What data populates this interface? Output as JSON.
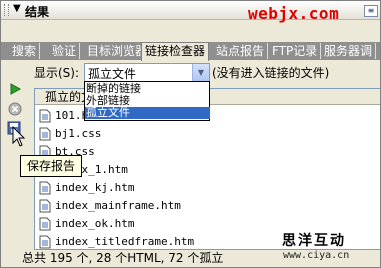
{
  "panel": {
    "title": "结果",
    "watermark": "webjx.com"
  },
  "tabs": [
    {
      "label": "搜索"
    },
    {
      "label": "验证"
    },
    {
      "label": "目标浏览器"
    },
    {
      "label": "链接检查器",
      "active": true
    },
    {
      "label": "站点报告"
    },
    {
      "label": "FTP记录"
    },
    {
      "label": "服务器调"
    }
  ],
  "toolbar": {
    "show_label": "显示(S):",
    "show_value": "孤立文件",
    "hint": "(没有进入链接的文件)"
  },
  "dropdown": {
    "options": [
      "断掉的链接",
      "外部链接",
      "孤立文件"
    ],
    "selected_index": 2
  },
  "list": {
    "header": "孤立的文件",
    "rows": [
      "101.htm",
      "bj1.css",
      "bt.css",
      "index_1.htm",
      "index_kj.htm",
      "index_mainframe.htm",
      "index_ok.htm",
      "index_titledframe.htm"
    ]
  },
  "tooltip": "保存报告",
  "status": "总共 195 个, 28 个HTML, 72 个孤立",
  "brand": {
    "name": "思洋互动",
    "url": "www.ciya.cn"
  },
  "colors": {
    "watermark": "#e00000",
    "selection": "#316ac5",
    "tooltip_bg": "#ffffe1"
  }
}
